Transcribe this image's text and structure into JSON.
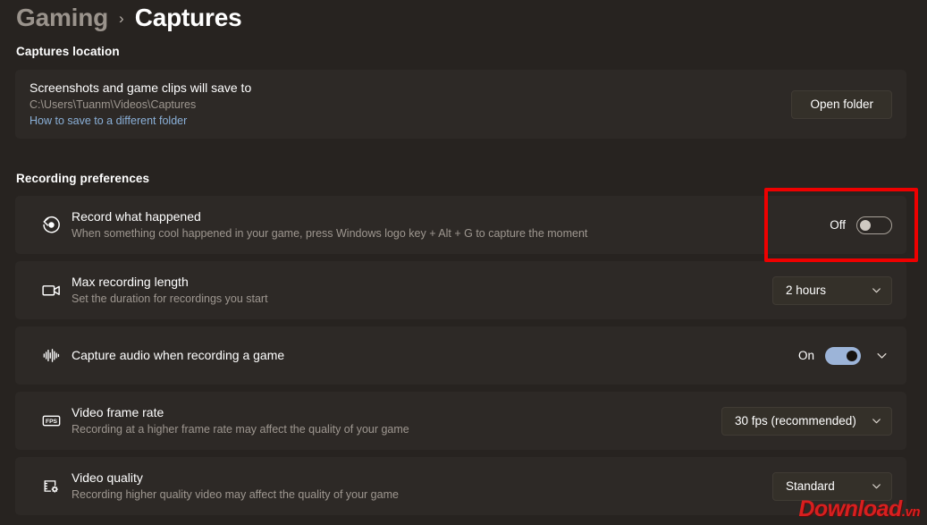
{
  "breadcrumb": {
    "parent": "Gaming",
    "separator": "›",
    "current": "Captures"
  },
  "sections": {
    "captures_location": "Captures location",
    "recording_preferences": "Recording preferences"
  },
  "location_card": {
    "title": "Screenshots and game clips will save to",
    "path": "C:\\Users\\Tuanm\\Videos\\Captures",
    "link": "How to save to a different folder",
    "button": "Open folder"
  },
  "rows": {
    "record": {
      "icon": "record-replay-icon",
      "title": "Record what happened",
      "subtitle": "When something cool happened in your game, press Windows logo key + Alt + G to capture the moment",
      "toggle_label": "Off",
      "toggle_state": "off"
    },
    "length": {
      "icon": "video-camera-icon",
      "title": "Max recording length",
      "subtitle": "Set the duration for recordings you start",
      "value": "2 hours"
    },
    "audio": {
      "icon": "audio-waveform-icon",
      "title": "Capture audio when recording a game",
      "subtitle": "",
      "toggle_label": "On",
      "toggle_state": "on"
    },
    "fps": {
      "icon": "fps-badge-icon",
      "title": "Video frame rate",
      "subtitle": "Recording at a higher frame rate may affect the quality of your game",
      "value": "30 fps (recommended)"
    },
    "quality": {
      "icon": "video-quality-icon",
      "title": "Video quality",
      "subtitle": "Recording higher quality video may affect the quality of your game",
      "value": "Standard"
    }
  },
  "annotation": {
    "color": "#ee0000",
    "target": "record-what-happened-toggle"
  },
  "watermark": {
    "name": "Download",
    "tld": ".vn",
    "color": "#d81f1f"
  },
  "colors": {
    "page_background": "#272320",
    "card_background": "#2d2926",
    "control_background": "#343029",
    "accent_toggle_on": "#9cb4d8",
    "link": "#8ab0d8",
    "secondary_text": "#9e9790"
  }
}
